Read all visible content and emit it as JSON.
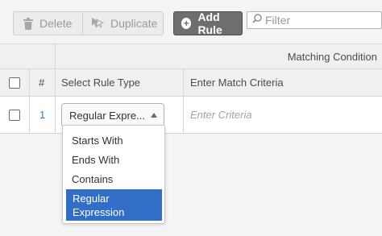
{
  "toolbar": {
    "delete_label": "Delete",
    "duplicate_label": "Duplicate",
    "add_rule_label": "Add Rule",
    "filter_placeholder": "Filter"
  },
  "table": {
    "group_header": "Matching Condition",
    "columns": {
      "number": "#",
      "rule_type": "Select Rule Type",
      "criteria": "Enter Match Criteria"
    },
    "rows": [
      {
        "number": "1",
        "rule_type_value": "Regular Expre...",
        "criteria_placeholder": "Enter Criteria"
      }
    ]
  },
  "dropdown": {
    "options": [
      "Starts With",
      "Ends With",
      "Contains",
      "Regular Expression"
    ],
    "selected_lines": [
      "Regular",
      "Expression"
    ]
  },
  "icons": {
    "delete": "trash-icon",
    "duplicate": "duplicate-icon",
    "add": "plus-circle-icon",
    "filter": "search-icon",
    "select": "triangle-up-icon"
  },
  "colors": {
    "accent": "#326ec8",
    "link": "#2d7cc8",
    "add_button": "#6e6e6e"
  }
}
